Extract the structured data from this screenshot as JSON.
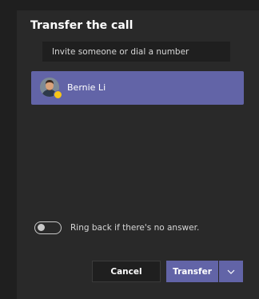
{
  "dialog": {
    "title": "Transfer the call",
    "search": {
      "value": "",
      "placeholder": "Invite someone or dial a number"
    },
    "selected_person": {
      "name": "Bernie Li",
      "presence_color": "#f8c617"
    },
    "ring_back": {
      "label": "Ring back if there's no answer.",
      "enabled": false
    },
    "buttons": {
      "cancel": "Cancel",
      "transfer": "Transfer",
      "more_icon": "chevron-down-icon"
    },
    "colors": {
      "accent": "#6264a7",
      "panel": "#292929",
      "background": "#1f1f1f"
    }
  }
}
